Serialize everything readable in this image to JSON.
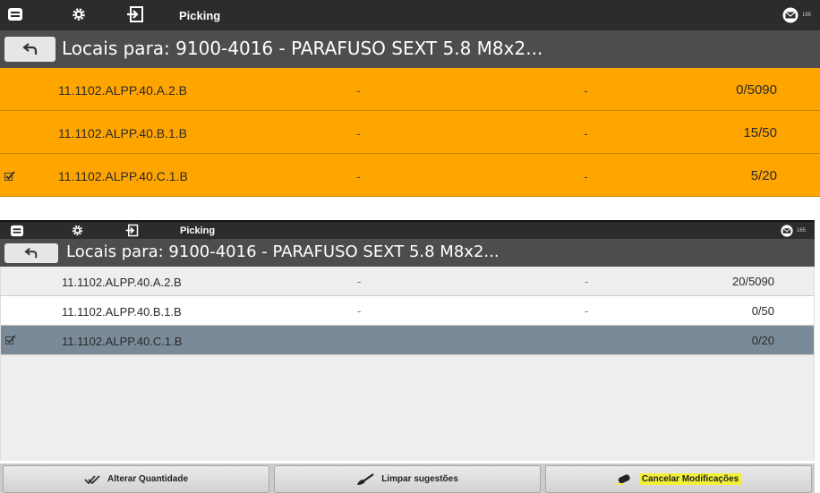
{
  "panels": [
    {
      "topbar": {
        "title": "Picking",
        "badge": "165"
      },
      "header": {
        "title": "Locais para: 9100-4016 - PARAFUSO SEXT 5.8  M8x2..."
      },
      "rows": [
        {
          "location": "11.1102.ALPP.40.A.2.B",
          "col2": "-",
          "col3": "-",
          "qty": "0/5090",
          "checked": false
        },
        {
          "location": "11.1102.ALPP.40.B.1.B",
          "col2": "-",
          "col3": "-",
          "qty": "15/50",
          "checked": false
        },
        {
          "location": "11.1102.ALPP.40.C.1.B",
          "col2": "-",
          "col3": "-",
          "qty": "5/20",
          "checked": true
        }
      ]
    },
    {
      "topbar": {
        "title": "Picking",
        "badge": "165"
      },
      "header": {
        "title": "Locais para: 9100-4016 - PARAFUSO SEXT 5.8  M8x2..."
      },
      "rows": [
        {
          "location": "11.1102.ALPP.40.A.2.B",
          "col2": "-",
          "col3": "-",
          "qty": "20/5090",
          "checked": false
        },
        {
          "location": "11.1102.ALPP.40.B.1.B",
          "col2": "-",
          "col3": "-",
          "qty": "0/50",
          "checked": false
        },
        {
          "location": "11.1102.ALPP.40.C.1.B",
          "col2": "-",
          "col3": "-",
          "qty": "0/20",
          "checked": true
        }
      ]
    }
  ],
  "bottom_buttons": [
    {
      "label": "Alterar Quantidade",
      "icon": "double-check-icon"
    },
    {
      "label": "Limpar sugestões",
      "icon": "brush-icon"
    },
    {
      "label": "Cancelar Modificações",
      "icon": "eraser-icon",
      "highlighted": true
    }
  ],
  "colors": {
    "topbar": "#2c2c2c",
    "header": "#4d4d4d",
    "row_orange": "#ffa500",
    "row_selected": "#7a8a99"
  }
}
